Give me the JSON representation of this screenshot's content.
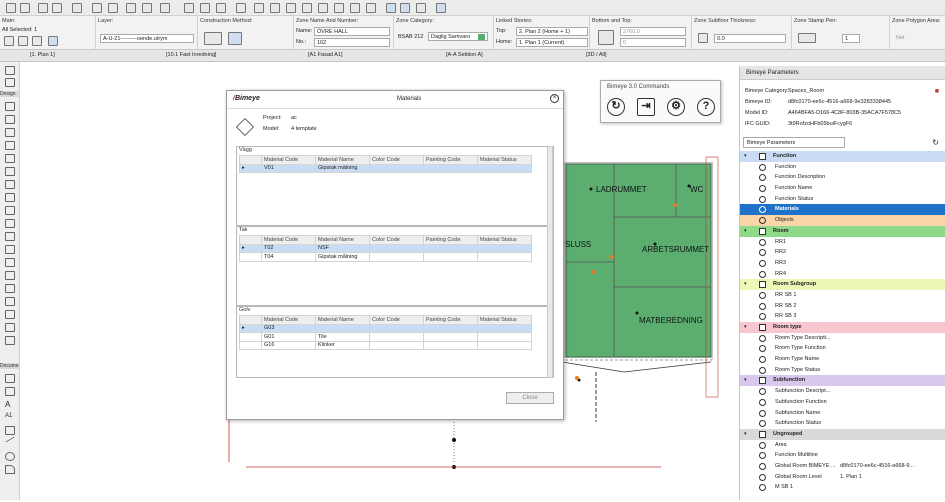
{
  "toolbar": {
    "main_label": "Main:",
    "all_selected": "All Selected: 1"
  },
  "infobar": {
    "layer_label": "Layer:",
    "layer_value": "A-U-21---------oende.utrym",
    "construction_label": "Construction Method:",
    "zone_name_label": "Zone Name And Number:",
    "name_label": "Name:",
    "name_value": "ÖVRE HALL",
    "no_label": "No.:",
    "no_value": "102",
    "zone_category_label": "Zone Category:",
    "category_code": "BSAB 212",
    "category_name": "Daglig Samvaro",
    "linked_stories_label": "Linked Stories:",
    "top_label": "Top:",
    "top_value": "2. Plan 2 (Home + 1)",
    "home_label": "Home:",
    "home_value": "1. Plan 1 (Current)",
    "bottom_top_label": "Bottom and Top:",
    "height_value": "2760.0",
    "bottom_value": "0",
    "subfloor_label": "Zone Subfloor Thickness:",
    "subfloor_value": "0.0",
    "stamp_pen_label": "Zone Stamp Pen:",
    "pen_value": "1",
    "polygon_label": "Zone Polygon Area:",
    "polygon_value": "Net"
  },
  "tabs": [
    "[1. Plan 1]",
    "[10.1 Fast Inredning]",
    "[A1 Fasad A1]",
    "[A-A Sektion A]",
    "[3D / All]"
  ],
  "left_tools": {
    "design_label": "Design",
    "document_label": "Docume"
  },
  "plan_labels": [
    "LADRUMMET",
    "WC",
    "SLUSS",
    "ARBETSRUMMET",
    "MATBEREDNING"
  ],
  "materials_dialog": {
    "logo_text": "Bimeye",
    "title": "Materials",
    "close_label": "Close",
    "project_label": "Project:",
    "project_value": "ac",
    "model_label": "Model:",
    "model_value": "4 template",
    "columns": [
      "Material Code",
      "Material Name",
      "Color Code",
      "Painting Code",
      "Material Status"
    ],
    "sections": [
      {
        "title": "Vägg",
        "rows": [
          [
            "V01",
            "Gipstak målning",
            "",
            "",
            ""
          ]
        ]
      },
      {
        "title": "Tak",
        "rows": [
          [
            "T02",
            "NSF",
            "",
            "",
            ""
          ],
          [
            "T04",
            "Gipstak målning",
            "",
            "",
            ""
          ]
        ]
      },
      {
        "title": "Golv",
        "rows": [
          [
            "G03",
            "",
            "",
            "",
            ""
          ],
          [
            "G01",
            "Tile",
            "",
            "",
            ""
          ],
          [
            "G16",
            "Klinker",
            "",
            "",
            ""
          ]
        ]
      }
    ]
  },
  "commands_panel": {
    "title": "Bimeye 3.0 Commands",
    "icons": [
      "refresh-icon",
      "export-icon",
      "settings-icon",
      "help-icon"
    ]
  },
  "right_panel": {
    "title": "Bimeye Parameters",
    "info": [
      {
        "label": "Bimeye Category:",
        "value": "Spaces_Room"
      },
      {
        "label": "Bimeye ID:",
        "value": "d8fc0170-ee6c-4516-a668-9e3283338445"
      },
      {
        "label": "Model ID:",
        "value": "A464BFA5-D166-4C8F-803B-35ACA7F578C5"
      },
      {
        "label": "IFC GUID:",
        "value": "3t9RofzoHFb05buiFcygF6"
      }
    ],
    "dropdown_value": "Bimeye Parameters",
    "tree": [
      {
        "type": "group",
        "label": "Function",
        "color": "#c9dcf3"
      },
      {
        "type": "item",
        "label": "Function"
      },
      {
        "type": "item",
        "label": "Function Description"
      },
      {
        "type": "item",
        "label": "Function Name"
      },
      {
        "type": "item",
        "label": "Function Status"
      },
      {
        "type": "selected",
        "label": "Materials",
        "color": "#1f72c9"
      },
      {
        "type": "item-eye",
        "label": "Objects",
        "color": "#f9d5a8"
      },
      {
        "type": "group",
        "label": "Room",
        "color": "#8fda8a"
      },
      {
        "type": "item",
        "label": "RR1"
      },
      {
        "type": "item",
        "label": "RR2"
      },
      {
        "type": "item",
        "label": "RR3"
      },
      {
        "type": "item",
        "label": "RR4"
      },
      {
        "type": "group",
        "label": "Room Subgroup",
        "color": "#eef7b5"
      },
      {
        "type": "item",
        "label": "RR SB 1"
      },
      {
        "type": "item",
        "label": "RR SB 2"
      },
      {
        "type": "item",
        "label": "RR SB 3"
      },
      {
        "type": "group",
        "label": "Room type",
        "color": "#f9c6d0"
      },
      {
        "type": "item",
        "label": "Room Type Descripti..."
      },
      {
        "type": "item",
        "label": "Room Type Function"
      },
      {
        "type": "item",
        "label": "Room Type Name"
      },
      {
        "type": "item",
        "label": "Room Type Status"
      },
      {
        "type": "group",
        "label": "Subfunction",
        "color": "#d8c9ec"
      },
      {
        "type": "item",
        "label": "Subfunction Descript..."
      },
      {
        "type": "item",
        "label": "Subfunction Function"
      },
      {
        "type": "item",
        "label": "Subfunction Name"
      },
      {
        "type": "item",
        "label": "Subfunction Status"
      },
      {
        "type": "group",
        "label": "Ungrouped",
        "color": "#d9d9d9"
      },
      {
        "type": "item",
        "label": "Area"
      },
      {
        "type": "item",
        "label": "Function Multiline"
      },
      {
        "type": "item",
        "label": "Global Room BIMEYE ...",
        "value": "d8fc0170-ee6c-4516-a668-9..."
      },
      {
        "type": "item",
        "label": "Global Room Level",
        "value": "1. Plan 1"
      },
      {
        "type": "item",
        "label": "M SB 1"
      }
    ]
  }
}
